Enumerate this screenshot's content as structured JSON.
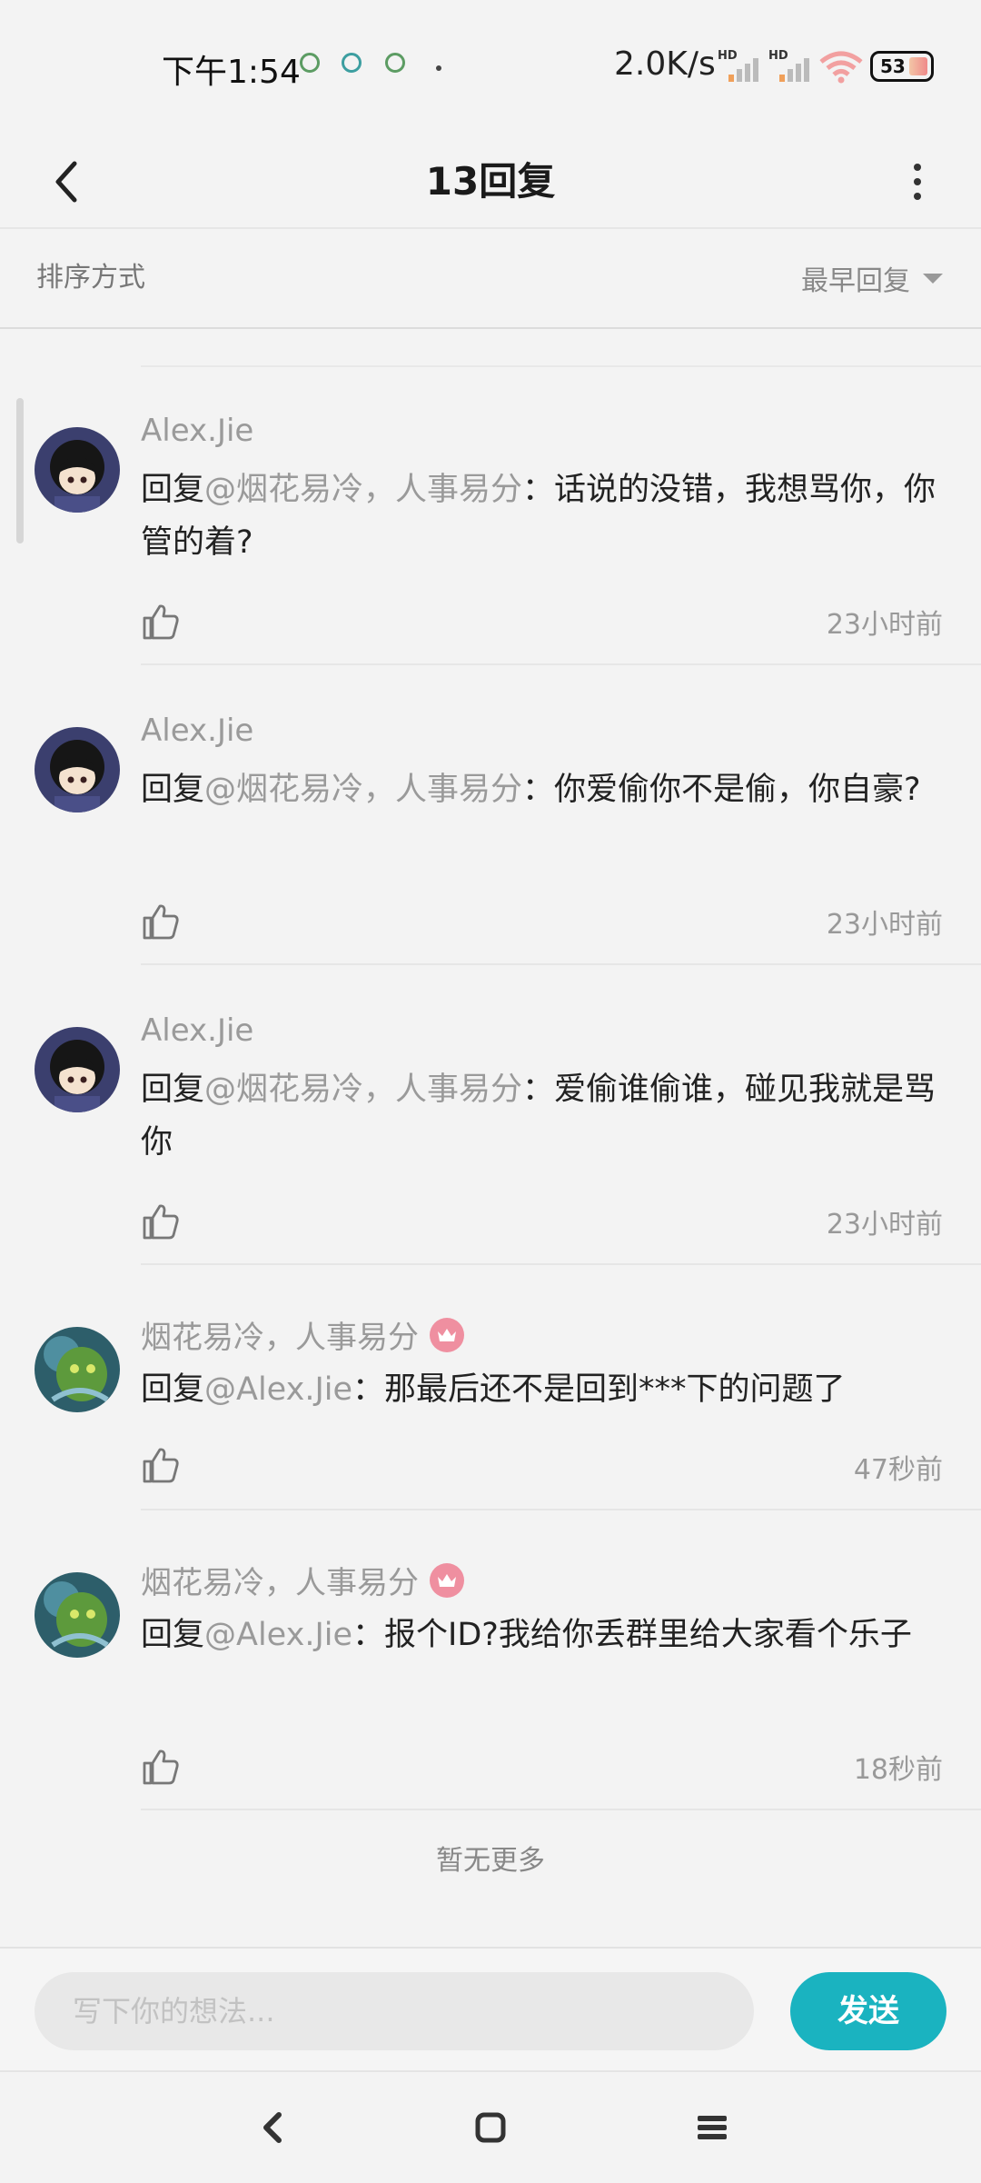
{
  "status_bar": {
    "time": "下午1:54",
    "net_speed": "2.0K/s",
    "hd_badge": "HD",
    "battery": "53"
  },
  "header": {
    "title": "13回复"
  },
  "sort": {
    "label": "排序方式",
    "selected": "最早回复"
  },
  "comments": [
    {
      "username": "Alex.Jie",
      "reply_prefix": "回复",
      "mention": "@烟花易冷，人事易分",
      "text": "：话说的没错，我想骂你，你管的着?",
      "time": "23小时前",
      "avatar": "dark-haired-girl-avatar",
      "vip": false
    },
    {
      "username": "Alex.Jie",
      "reply_prefix": "回复",
      "mention": "@烟花易冷，人事易分",
      "text": "：你爱偷你不是偷，你自豪?",
      "time": "23小时前",
      "avatar": "dark-haired-girl-avatar",
      "vip": false
    },
    {
      "username": "Alex.Jie",
      "reply_prefix": "回复",
      "mention": "@烟花易冷，人事易分",
      "text": "：爱偷谁偷谁，碰见我就是骂你",
      "time": "23小时前",
      "avatar": "dark-haired-girl-avatar",
      "vip": false
    },
    {
      "username": "烟花易冷，人事易分",
      "reply_prefix": "回复",
      "mention": "@Alex.Jie",
      "text": "：那最后还不是回到***下的问题了",
      "time": "47秒前",
      "avatar": "green-creature-avatar",
      "vip": true
    },
    {
      "username": "烟花易冷，人事易分",
      "reply_prefix": "回复",
      "mention": "@Alex.Jie",
      "text": "：报个ID?我给你丢群里给大家看个乐子",
      "time": "18秒前",
      "avatar": "green-creature-avatar",
      "vip": true
    }
  ],
  "no_more": "暂无更多",
  "input": {
    "placeholder": "写下你的想法...",
    "value": ""
  },
  "send_label": "发送",
  "colors": {
    "accent": "#1ab3c0",
    "vip_badge": "#ef8fa0",
    "muted_text": "#9a9a9a"
  },
  "icons": [
    "back-arrow-icon",
    "more-vertical-icon",
    "dropdown-triangle-icon",
    "thumbs-up-icon",
    "crown-icon",
    "nav-back-icon",
    "nav-home-icon",
    "nav-menu-icon"
  ]
}
